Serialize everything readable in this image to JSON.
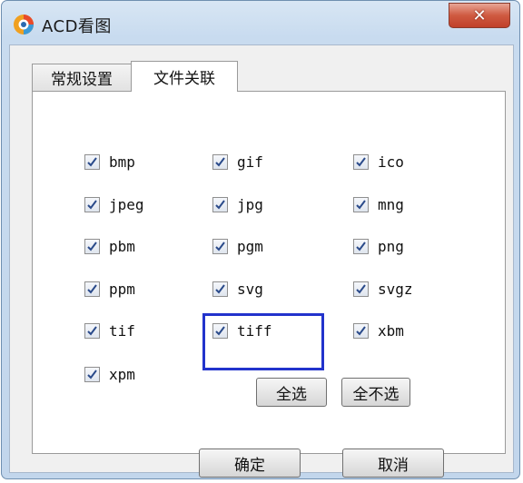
{
  "window": {
    "title": "ACD看图",
    "close_label": "✕"
  },
  "tabs": [
    {
      "label": "常规设置",
      "active": false
    },
    {
      "label": "文件关联",
      "active": true
    }
  ],
  "file_types": [
    {
      "ext": "bmp",
      "checked": true
    },
    {
      "ext": "gif",
      "checked": true
    },
    {
      "ext": "ico",
      "checked": true
    },
    {
      "ext": "jpeg",
      "checked": true
    },
    {
      "ext": "jpg",
      "checked": true
    },
    {
      "ext": "mng",
      "checked": true
    },
    {
      "ext": "pbm",
      "checked": true
    },
    {
      "ext": "pgm",
      "checked": true
    },
    {
      "ext": "png",
      "checked": true
    },
    {
      "ext": "ppm",
      "checked": true
    },
    {
      "ext": "svg",
      "checked": true
    },
    {
      "ext": "svgz",
      "checked": true
    },
    {
      "ext": "tif",
      "checked": true
    },
    {
      "ext": "tiff",
      "checked": true
    },
    {
      "ext": "xbm",
      "checked": true
    },
    {
      "ext": "xpm",
      "checked": true
    }
  ],
  "buttons": {
    "select_all": "全选",
    "select_none": "全不选",
    "ok": "确定",
    "cancel": "取消"
  },
  "colors": {
    "highlight": "#2233cc",
    "close_button": "#c94a34"
  }
}
